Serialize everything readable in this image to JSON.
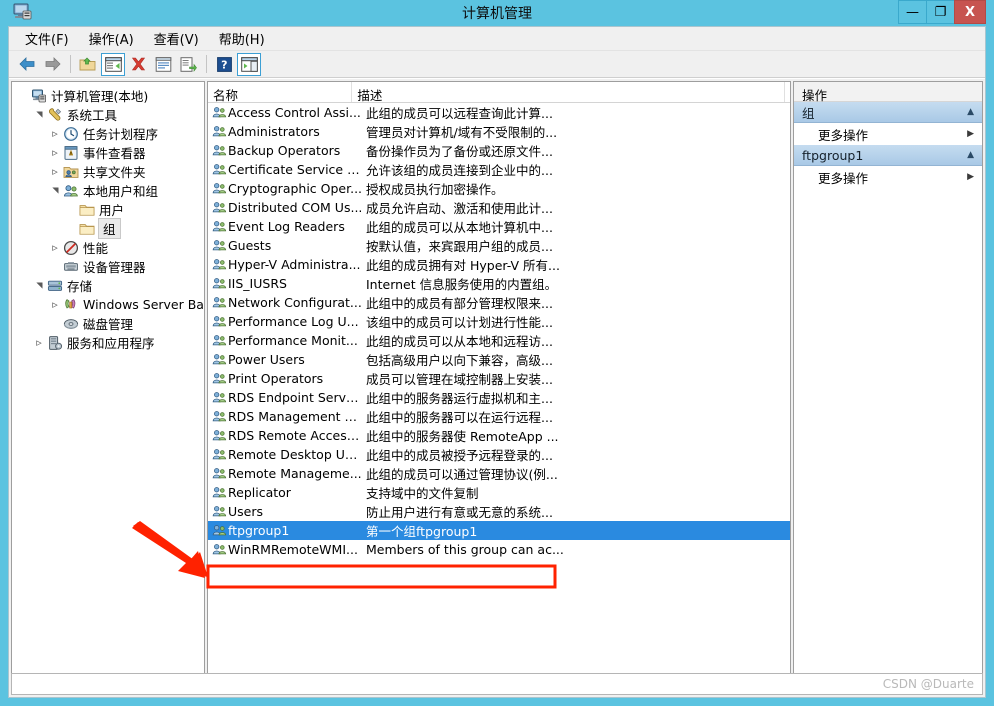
{
  "window": {
    "title": "计算机管理",
    "icon": "computer-management-icon",
    "minimize_label": "—",
    "maximize_label": "❐",
    "close_label": "X"
  },
  "menubar": {
    "items": [
      {
        "label": "文件(F)",
        "name": "menu-file"
      },
      {
        "label": "操作(A)",
        "name": "menu-action"
      },
      {
        "label": "查看(V)",
        "name": "menu-view"
      },
      {
        "label": "帮助(H)",
        "name": "menu-help"
      }
    ]
  },
  "toolbar": {
    "buttons": [
      {
        "name": "back-button",
        "icon": "back-arrow-icon",
        "framed": false
      },
      {
        "name": "forward-button",
        "icon": "forward-arrow-icon",
        "framed": false
      },
      {
        "name": "up-folder-button",
        "icon": "up-folder-icon",
        "framed": false
      },
      {
        "name": "show-tree-button",
        "icon": "show-console-tree-icon",
        "framed": true
      },
      {
        "name": "delete-button",
        "icon": "delete-red-x-icon",
        "framed": false
      },
      {
        "name": "properties-button",
        "icon": "properties-icon",
        "framed": false
      },
      {
        "name": "export-list-button",
        "icon": "export-list-icon",
        "framed": false
      },
      {
        "name": "help-button",
        "icon": "help-question-icon",
        "framed": false
      },
      {
        "name": "show-action-pane-button",
        "icon": "show-action-pane-icon",
        "framed": true
      }
    ]
  },
  "tree": {
    "items": [
      {
        "label": "计算机管理(本地)",
        "icon": "computer-icon",
        "indent": 0,
        "twisty": "",
        "selected": false
      },
      {
        "label": "系统工具",
        "icon": "system-tools-icon",
        "indent": 1,
        "twisty": "expanded",
        "selected": false
      },
      {
        "label": "任务计划程序",
        "icon": "task-scheduler-icon",
        "indent": 2,
        "twisty": "collapsed",
        "selected": false
      },
      {
        "label": "事件查看器",
        "icon": "event-viewer-icon",
        "indent": 2,
        "twisty": "collapsed",
        "selected": false
      },
      {
        "label": "共享文件夹",
        "icon": "shared-folders-icon",
        "indent": 2,
        "twisty": "collapsed",
        "selected": false
      },
      {
        "label": "本地用户和组",
        "icon": "local-users-groups-icon",
        "indent": 2,
        "twisty": "expanded",
        "selected": false
      },
      {
        "label": "用户",
        "icon": "folder-icon",
        "indent": 3,
        "twisty": "",
        "selected": false
      },
      {
        "label": "组",
        "icon": "folder-icon",
        "indent": 3,
        "twisty": "",
        "selected": true
      },
      {
        "label": "性能",
        "icon": "performance-icon",
        "indent": 2,
        "twisty": "collapsed",
        "selected": false
      },
      {
        "label": "设备管理器",
        "icon": "device-manager-icon",
        "indent": 2,
        "twisty": "",
        "selected": false
      },
      {
        "label": "存储",
        "icon": "storage-icon",
        "indent": 1,
        "twisty": "expanded",
        "selected": false
      },
      {
        "label": "Windows Server Back",
        "icon": "windows-server-backup-icon",
        "indent": 2,
        "twisty": "collapsed",
        "selected": false
      },
      {
        "label": "磁盘管理",
        "icon": "disk-management-icon",
        "indent": 2,
        "twisty": "",
        "selected": false
      },
      {
        "label": "服务和应用程序",
        "icon": "services-applications-icon",
        "indent": 1,
        "twisty": "collapsed",
        "selected": false
      }
    ],
    "scrollbar": {
      "left_label": "‹",
      "right_label": "›",
      "thumb_label": "III"
    }
  },
  "list": {
    "columns": [
      {
        "label": "名称",
        "name": "column-header-name"
      },
      {
        "label": "描述",
        "name": "column-header-description"
      }
    ],
    "rows": [
      {
        "name": "Access Control Assi...",
        "description": "此组的成员可以远程查询此计算...",
        "icon": "group-icon",
        "selected": false
      },
      {
        "name": "Administrators",
        "description": "管理员对计算机/域有不受限制的...",
        "icon": "group-icon",
        "selected": false
      },
      {
        "name": "Backup Operators",
        "description": "备份操作员为了备份或还原文件...",
        "icon": "group-icon",
        "selected": false
      },
      {
        "name": "Certificate Service D...",
        "description": "允许该组的成员连接到企业中的...",
        "icon": "group-icon",
        "selected": false
      },
      {
        "name": "Cryptographic Oper...",
        "description": "授权成员执行加密操作。",
        "icon": "group-icon",
        "selected": false
      },
      {
        "name": "Distributed COM Us...",
        "description": "成员允许启动、激活和使用此计...",
        "icon": "group-icon",
        "selected": false
      },
      {
        "name": "Event Log Readers",
        "description": "此组的成员可以从本地计算机中...",
        "icon": "group-icon",
        "selected": false
      },
      {
        "name": "Guests",
        "description": "按默认值，来宾跟用户组的成员...",
        "icon": "group-icon",
        "selected": false
      },
      {
        "name": "Hyper-V Administra...",
        "description": "此组的成员拥有对 Hyper-V 所有...",
        "icon": "group-icon",
        "selected": false
      },
      {
        "name": "IIS_IUSRS",
        "description": "Internet 信息服务使用的内置组。",
        "icon": "group-icon",
        "selected": false
      },
      {
        "name": "Network Configurat...",
        "description": "此组中的成员有部分管理权限来...",
        "icon": "group-icon",
        "selected": false
      },
      {
        "name": "Performance Log U...",
        "description": "该组中的成员可以计划进行性能...",
        "icon": "group-icon",
        "selected": false
      },
      {
        "name": "Performance Monit...",
        "description": "此组的成员可以从本地和远程访...",
        "icon": "group-icon",
        "selected": false
      },
      {
        "name": "Power Users",
        "description": "包括高级用户以向下兼容，高级...",
        "icon": "group-icon",
        "selected": false
      },
      {
        "name": "Print Operators",
        "description": "成员可以管理在域控制器上安装...",
        "icon": "group-icon",
        "selected": false
      },
      {
        "name": "RDS Endpoint Serve...",
        "description": "此组中的服务器运行虚拟机和主...",
        "icon": "group-icon",
        "selected": false
      },
      {
        "name": "RDS Management S...",
        "description": "此组中的服务器可以在运行远程...",
        "icon": "group-icon",
        "selected": false
      },
      {
        "name": "RDS Remote Access...",
        "description": "此组中的服务器使 RemoteApp ...",
        "icon": "group-icon",
        "selected": false
      },
      {
        "name": "Remote Desktop Us...",
        "description": "此组中的成员被授予远程登录的...",
        "icon": "group-icon",
        "selected": false
      },
      {
        "name": "Remote Manageme...",
        "description": "此组的成员可以通过管理协议(例...",
        "icon": "group-icon",
        "selected": false
      },
      {
        "name": "Replicator",
        "description": "支持域中的文件复制",
        "icon": "group-icon",
        "selected": false
      },
      {
        "name": "Users",
        "description": "防止用户进行有意或无意的系统...",
        "icon": "group-icon",
        "selected": false
      },
      {
        "name": "ftpgroup1",
        "description": "第一个组ftpgroup1",
        "icon": "group-icon",
        "selected": true
      },
      {
        "name": "WinRMRemoteWMI...",
        "description": "Members of this group can ac...",
        "icon": "group-icon",
        "selected": false
      }
    ]
  },
  "actions": {
    "title": "操作",
    "groups": [
      {
        "header": "组",
        "name": "actions-group-groups",
        "chevron": "▲",
        "items": [
          {
            "label": "更多操作",
            "name": "more-actions-groups",
            "arrow": "▶"
          }
        ]
      },
      {
        "header": "ftpgroup1",
        "name": "actions-group-ftpgroup1",
        "chevron": "▲",
        "items": [
          {
            "label": "更多操作",
            "name": "more-actions-ftpgroup1",
            "arrow": "▶"
          }
        ]
      }
    ]
  },
  "statusbar": {
    "watermark": "CSDN @Duarte"
  },
  "annotations": {
    "arrow_color": "#FF2200",
    "highlight_color": "#FF2200"
  }
}
